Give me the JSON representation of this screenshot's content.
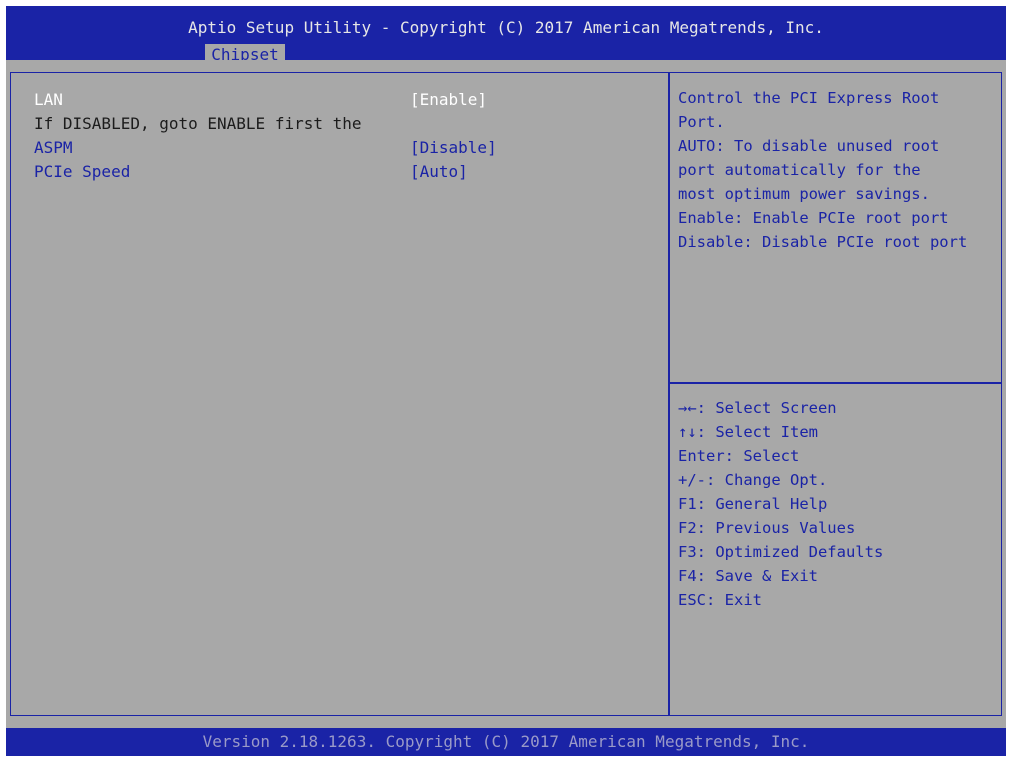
{
  "header": {
    "title": "Aptio Setup Utility - Copyright (C) 2017 American Megatrends, Inc.",
    "tab": "Chipset"
  },
  "settings": {
    "lan": {
      "label": "LAN",
      "value": "[Enable]"
    },
    "note": "If DISABLED, goto ENABLE first the",
    "aspm": {
      "label": "ASPM",
      "value": "[Disable]"
    },
    "pcie_speed": {
      "label": "PCIe Speed",
      "value": "[Auto]"
    }
  },
  "help": {
    "lines": [
      "Control the PCI Express Root",
      "Port.",
      "AUTO: To disable unused root",
      "port automatically for the",
      "most optimum power savings.",
      "Enable: Enable PCIe root port",
      "Disable: Disable PCIe root port"
    ]
  },
  "keys": {
    "lines": [
      "→←: Select Screen",
      "↑↓: Select Item",
      "Enter: Select",
      "+/-: Change Opt.",
      "F1: General Help",
      "F2: Previous Values",
      "F3: Optimized Defaults",
      "F4: Save & Exit",
      "ESC: Exit"
    ]
  },
  "footer": {
    "text": "Version 2.18.1263. Copyright (C) 2017 American Megatrends, Inc."
  },
  "colors": {
    "bar_blue": "#1a23a6",
    "panel_gray": "#a8a8a8",
    "selected_text": "#ffffff"
  }
}
